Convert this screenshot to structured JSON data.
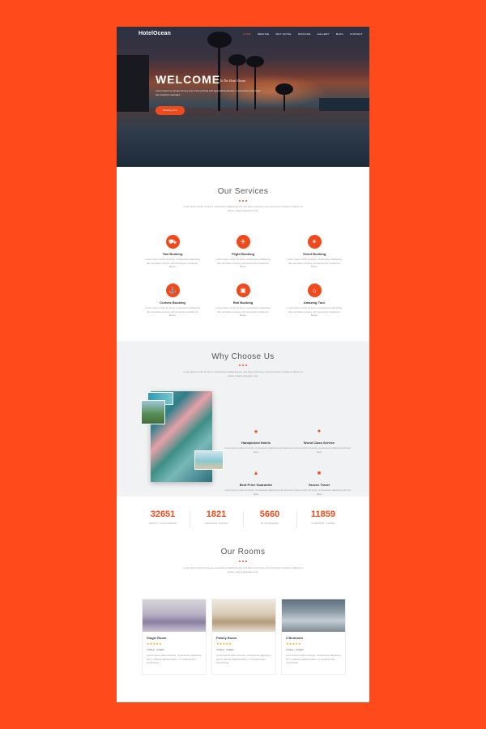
{
  "nav": {
    "logo": "HotelOcean",
    "items": [
      "HOME",
      "SERVICE",
      "WHY HOTEL",
      "PACKAGE",
      "GALLERY",
      "BLOG",
      "CONTACT"
    ]
  },
  "hero": {
    "title": "WELCOME",
    "subtitle": "To The Hotel Ocean",
    "text": "Lorem Ipsum is simply dummy text of the printing and typesetting industry. Lorem Ipsum has been the industry's standard.",
    "button": "Booking Now"
  },
  "services": {
    "title": "Our Services",
    "desc": "Lorem ipsum dolor sit amet, consectetur adipiscing elit, sed diam nonummy eirmod tempor invidunt ut labore et dolore magna aliquyam erat.",
    "items": [
      {
        "icon": "taxi-icon",
        "title": "Taxi Booking",
        "desc": "Lorem ipsum dolor sit amet, consectetur adipiscing elit, sed diam nonumy eirmod tempor invidunt ut labore"
      },
      {
        "icon": "airplane-icon",
        "title": "Flight Booking",
        "desc": "Lorem ipsum dolor sit amet, consectetur adipiscing elit, sed diam nonumy eirmod tempor invidunt ut labore"
      },
      {
        "icon": "ticket-icon",
        "title": "Ticket Booking",
        "desc": "Lorem ipsum dolor sit amet, consectetur adipiscing elit, sed diam nonumy eirmod tempor invidunt ut labore"
      },
      {
        "icon": "ship-icon",
        "title": "Cruises Booking",
        "desc": "Lorem ipsum dolor sit amet, consectetur adipiscing elit, sed diam nonumy eirmod tempor invidunt ut labore"
      },
      {
        "icon": "train-icon",
        "title": "Rail Booking",
        "desc": "Lorem ipsum dolor sit amet, consectetur adipiscing elit, sed diam nonumy eirmod tempor invidunt ut labore"
      },
      {
        "icon": "home-icon",
        "title": "Amazing Tour",
        "desc": "Lorem ipsum dolor sit amet, consectetur adipiscing elit, sed diam nonumy eirmod tempor invidunt ut labore"
      }
    ]
  },
  "why": {
    "title": "Why Choose Us",
    "desc": "Lorem ipsum dolor sit amet, consectetur adipiscing elit, sed diam nonummy eirmod tempor invidunt ut labore et dolore magna aliquyam erat.",
    "features": [
      {
        "icon": "star-icon",
        "title": "Handpicked Hotels",
        "desc": "Lorem ipsum dolor sit amet, consectetur adipiscing elit sed diam"
      },
      {
        "icon": "globe-icon",
        "title": "World Class Service",
        "desc": "Lorem ipsum dolor sit amet, consectetur adipiscing elit sed diam"
      },
      {
        "icon": "thumbs-up-icon",
        "title": "Best Price Guarantee",
        "desc": "Lorem ipsum dolor sit amet, consectetur adipiscing elit sed diam"
      },
      {
        "icon": "shield-icon",
        "title": "Secure Travel",
        "desc": "Lorem ipsum dolor sit amet, consectetur adipiscing elit sed diam"
      }
    ]
  },
  "stats": [
    {
      "value": "32651",
      "label": "HAPPY CUSTOMERS"
    },
    {
      "value": "1821",
      "label": "AMAZING TOURS"
    },
    {
      "value": "5660",
      "label": "IN BUSINESS"
    },
    {
      "value": "11859",
      "label": "SUPPORT CASES"
    }
  ],
  "rooms": {
    "title": "Our Rooms",
    "desc": "Lorem ipsum dolor sit amet, consectetur adipiscing elit, sed diam nonummy eirmod tempor invidunt ut labore et dolore magna aliquyam erat.",
    "items": [
      {
        "title": "Single Room",
        "stars": "★★★★★",
        "meta": "3 Days - 4 Night",
        "desc": "Lorem ipsum dolor sit amet, consectetur adipiscing elit. In efficitur dapibus libero, ut condimentum scelerisque."
      },
      {
        "title": "Family Room",
        "stars": "★★★★★",
        "meta": "3 Days - 4 Night",
        "desc": "Lorem ipsum dolor sit amet, consectetur adipiscing elit. In efficitur dapibus libero, ut condimentum scelerisque."
      },
      {
        "title": "2 Bedroom",
        "stars": "★★★★★",
        "meta": "3 Days - 4 Night",
        "desc": "Lorem ipsum dolor sit amet, consectetur adipiscing elit. In efficitur dapibus libero, ut condimentum scelerisque."
      }
    ]
  },
  "colors": {
    "accent": "#f04a1c",
    "background": "#ff4a1c"
  }
}
